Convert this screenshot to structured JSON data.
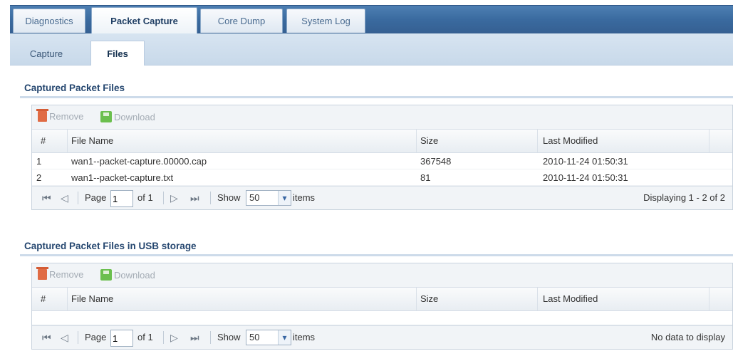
{
  "tabs": [
    "Diagnostics",
    "Packet Capture",
    "Core Dump",
    "System Log"
  ],
  "active_tab": "Packet Capture",
  "subtabs": [
    "Capture",
    "Files"
  ],
  "active_subtab": "Files",
  "section1": {
    "title": "Captured Packet Files",
    "toolbar": {
      "remove": "Remove",
      "download": "Download"
    },
    "columns": [
      "#",
      "File Name",
      "Size",
      "Last Modified"
    ],
    "rows": [
      [
        "1",
        "wan1--packet-capture.00000.cap",
        "367548",
        "2010-11-24 01:50:31"
      ],
      [
        "2",
        "wan1--packet-capture.txt",
        "81",
        "2010-11-24 01:50:31"
      ]
    ],
    "pager": {
      "page_label": "Page",
      "page_value": "1",
      "of_label": "of 1",
      "show_label": "Show",
      "show_value": "50",
      "items_label": "items",
      "status": "Displaying 1 - 2 of 2"
    }
  },
  "section2": {
    "title": "Captured Packet Files in USB storage",
    "toolbar": {
      "remove": "Remove",
      "download": "Download"
    },
    "columns": [
      "#",
      "File Name",
      "Size",
      "Last Modified"
    ],
    "rows": [],
    "pager": {
      "page_label": "Page",
      "page_value": "1",
      "of_label": "of 1",
      "show_label": "Show",
      "show_value": "50",
      "items_label": "items",
      "status": "No data to display"
    }
  }
}
